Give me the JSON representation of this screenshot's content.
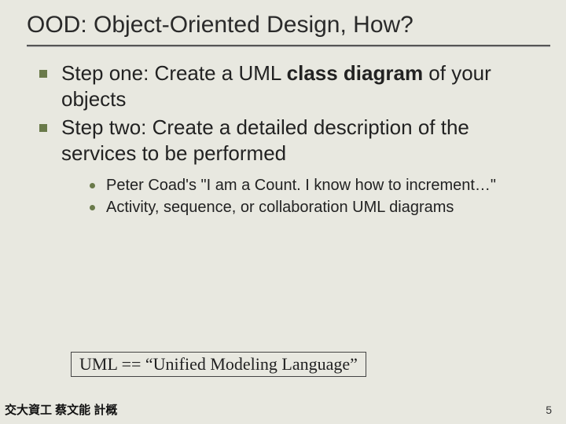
{
  "title": "OOD: Object-Oriented Design, How?",
  "bullets": {
    "l1": [
      {
        "pre": "Step one: Create a UML ",
        "bold": "class diagram",
        "post": " of your objects"
      },
      {
        "pre": "Step two: Create a detailed description of the services to be performed",
        "bold": "",
        "post": ""
      }
    ],
    "l2": [
      "Peter Coad's \"I am a Count. I know how to increment…\"",
      "Activity, sequence, or collaboration UML diagrams"
    ]
  },
  "footnote": "UML  == “Unified Modeling Language”",
  "footer_left": "交大資工 蔡文能 計概",
  "page_number": "5"
}
